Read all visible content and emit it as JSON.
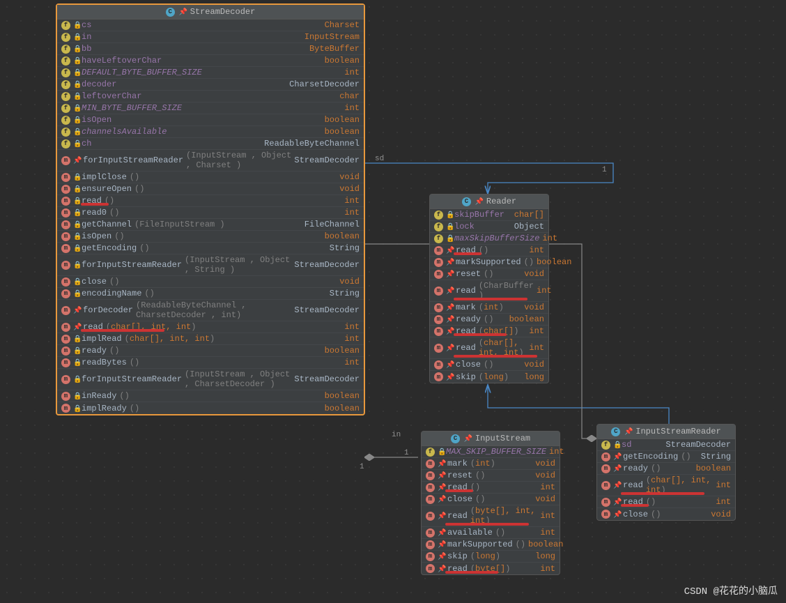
{
  "watermark": "CSDN @花花的小脑瓜",
  "edgeLabels": {
    "sd": "sd",
    "one1": "1",
    "one2": "1",
    "one3": "1",
    "in": "in"
  },
  "streamDecoder": {
    "title": "StreamDecoder",
    "rows": [
      {
        "ic": "f",
        "lock": true,
        "name": "cs",
        "type": "Charset",
        "purple": true
      },
      {
        "ic": "f",
        "lock": true,
        "name": "in",
        "type": "InputStream",
        "purple": true
      },
      {
        "ic": "f",
        "lock": true,
        "name": "bb",
        "type": "ByteBuffer",
        "purple": true
      },
      {
        "ic": "f",
        "lock": true,
        "name": "haveLeftoverChar",
        "type": "boolean",
        "purple": true
      },
      {
        "ic": "f",
        "lock": true,
        "name": "DEFAULT_BYTE_BUFFER_SIZE",
        "type": "int",
        "italic": true,
        "purple": true
      },
      {
        "ic": "f",
        "lock": true,
        "name": "decoder",
        "type": "CharsetDecoder",
        "purple": true,
        "typegrey": true
      },
      {
        "ic": "f",
        "lock": true,
        "name": "leftoverChar",
        "type": "char",
        "purple": true
      },
      {
        "ic": "f",
        "lock": true,
        "name": "MIN_BYTE_BUFFER_SIZE",
        "type": "int",
        "italic": true,
        "purple": true
      },
      {
        "ic": "f",
        "lock": true,
        "name": "isOpen",
        "type": "boolean",
        "purple": true
      },
      {
        "ic": "f",
        "lock": true,
        "name": "channelsAvailable",
        "type": "boolean",
        "italic": true,
        "purple": true
      },
      {
        "ic": "f",
        "lock": true,
        "name": "ch",
        "type": "ReadableByteChannel",
        "purple": true,
        "typegrey": true
      },
      {
        "ic": "m",
        "pin": true,
        "name": "forInputStreamReader",
        "params": "(InputStream , Object , Charset )",
        "type": "StreamDecoder",
        "typegrey": true
      },
      {
        "ic": "m",
        "lock": true,
        "name": "implClose",
        "params": "()",
        "type": "void"
      },
      {
        "ic": "m",
        "lock": true,
        "name": "ensureOpen",
        "params": "()",
        "type": "void"
      },
      {
        "ic": "m",
        "lock": true,
        "name": "read",
        "params": "()",
        "type": "int",
        "ul": true
      },
      {
        "ic": "m",
        "lock": true,
        "name": "read0",
        "params": "()",
        "type": "int"
      },
      {
        "ic": "m",
        "lock": true,
        "name": "getChannel",
        "params": "(FileInputStream )",
        "type": "FileChannel",
        "typegrey": true
      },
      {
        "ic": "m",
        "lock": true,
        "name": "isOpen",
        "params": "()",
        "type": "boolean"
      },
      {
        "ic": "m",
        "lock": true,
        "name": "getEncoding",
        "params": "()",
        "type": "String",
        "typegrey": true
      },
      {
        "ic": "m",
        "lock": true,
        "name": "forInputStreamReader",
        "params": "(InputStream , Object , String )",
        "type": "StreamDecoder",
        "typegrey": true
      },
      {
        "ic": "m",
        "lock": true,
        "name": "close",
        "params": "()",
        "type": "void"
      },
      {
        "ic": "m",
        "lock": true,
        "name": "encodingName",
        "params": "()",
        "type": "String",
        "typegrey": true
      },
      {
        "ic": "m",
        "pin": true,
        "name": "forDecoder",
        "params": "(ReadableByteChannel , CharsetDecoder , int)",
        "type": "StreamDecoder",
        "typegrey": true
      },
      {
        "ic": "m",
        "pin": true,
        "name": "read",
        "params": "(char[], int, int)",
        "type": "int",
        "ul": true,
        "kwparams": true
      },
      {
        "ic": "m",
        "lock": true,
        "name": "implRead",
        "params": "(char[], int, int)",
        "type": "int",
        "kwparams": true
      },
      {
        "ic": "m",
        "lock": true,
        "name": "ready",
        "params": "()",
        "type": "boolean"
      },
      {
        "ic": "m",
        "lock": true,
        "name": "readBytes",
        "params": "()",
        "type": "int"
      },
      {
        "ic": "m",
        "lock": true,
        "name": "forInputStreamReader",
        "params": "(InputStream , Object , CharsetDecoder )",
        "type": "StreamDecoder",
        "typegrey": true
      },
      {
        "ic": "m",
        "lock": true,
        "name": "inReady",
        "params": "()",
        "type": "boolean"
      },
      {
        "ic": "m",
        "lock": true,
        "name": "implReady",
        "params": "()",
        "type": "boolean"
      }
    ]
  },
  "reader": {
    "title": "Reader",
    "rows": [
      {
        "ic": "f",
        "lock": true,
        "name": "skipBuffer",
        "type": "char[]",
        "purple": true
      },
      {
        "ic": "f",
        "lock": true,
        "name": "lock",
        "type": "Object",
        "purple": true,
        "typegrey": true
      },
      {
        "ic": "f",
        "lock": true,
        "name": "maxSkipBufferSize",
        "type": "int",
        "italic": true,
        "purple": true
      },
      {
        "ic": "m",
        "pin": true,
        "name": "read",
        "params": "()",
        "type": "int",
        "ul": true
      },
      {
        "ic": "m",
        "pin": true,
        "name": "markSupported",
        "params": "()",
        "type": "boolean"
      },
      {
        "ic": "m",
        "pin": true,
        "name": "reset",
        "params": "()",
        "type": "void"
      },
      {
        "ic": "m",
        "pin": true,
        "name": "read",
        "params": "(CharBuffer )",
        "type": "int",
        "ul": true
      },
      {
        "ic": "m",
        "pin": true,
        "name": "mark",
        "params": "(int)",
        "type": "void",
        "kwparams": true
      },
      {
        "ic": "m",
        "pin": true,
        "name": "ready",
        "params": "()",
        "type": "boolean"
      },
      {
        "ic": "m",
        "pin": true,
        "name": "read",
        "params": "(char[])",
        "type": "int",
        "ul": true,
        "kwparams": true
      },
      {
        "ic": "m",
        "pin": true,
        "name": "read",
        "params": "(char[], int, int)",
        "type": "int",
        "ul": true,
        "kwparams": true
      },
      {
        "ic": "m",
        "pin": true,
        "name": "close",
        "params": "()",
        "type": "void"
      },
      {
        "ic": "m",
        "pin": true,
        "name": "skip",
        "params": "(long )",
        "type": "long",
        "kwparams": true
      }
    ]
  },
  "inputStream": {
    "title": "InputStream",
    "rows": [
      {
        "ic": "f",
        "lock": true,
        "name": "MAX_SKIP_BUFFER_SIZE",
        "type": "int",
        "italic": true,
        "purple": true
      },
      {
        "ic": "m",
        "pin": true,
        "name": "mark",
        "params": "(int)",
        "type": "void",
        "kwparams": true
      },
      {
        "ic": "m",
        "pin": true,
        "name": "reset",
        "params": "()",
        "type": "void"
      },
      {
        "ic": "m",
        "pin": true,
        "name": "read",
        "params": "()",
        "type": "int",
        "ul": true
      },
      {
        "ic": "m",
        "pin": true,
        "name": "close",
        "params": "()",
        "type": "void"
      },
      {
        "ic": "m",
        "pin": true,
        "name": "read",
        "params": "(byte[], int, int)",
        "type": "int",
        "ul": true,
        "kwparams": true
      },
      {
        "ic": "m",
        "pin": true,
        "name": "available",
        "params": "()",
        "type": "int"
      },
      {
        "ic": "m",
        "pin": true,
        "name": "markSupported",
        "params": "()",
        "type": "boolean"
      },
      {
        "ic": "m",
        "pin": true,
        "name": "skip",
        "params": "(long )",
        "type": "long",
        "kwparams": true
      },
      {
        "ic": "m",
        "pin": true,
        "name": "read",
        "params": "(byte[])",
        "type": "int",
        "ul": true,
        "kwparams": true
      }
    ]
  },
  "inputStreamReader": {
    "title": "InputStreamReader",
    "rows": [
      {
        "ic": "f",
        "lock": true,
        "name": "sd",
        "type": "StreamDecoder",
        "purple": true,
        "typegrey": true
      },
      {
        "ic": "m",
        "pin": true,
        "name": "getEncoding",
        "params": "()",
        "type": "String",
        "typegrey": true
      },
      {
        "ic": "m",
        "pin": true,
        "name": "ready",
        "params": "()",
        "type": "boolean"
      },
      {
        "ic": "m",
        "pin": true,
        "name": "read",
        "params": "(char[], int, int)",
        "type": "int",
        "ul": true,
        "kwparams": true
      },
      {
        "ic": "m",
        "pin": true,
        "name": "read",
        "params": "()",
        "type": "int",
        "ul": true
      },
      {
        "ic": "m",
        "pin": true,
        "name": "close",
        "params": "()",
        "type": "void"
      }
    ]
  }
}
